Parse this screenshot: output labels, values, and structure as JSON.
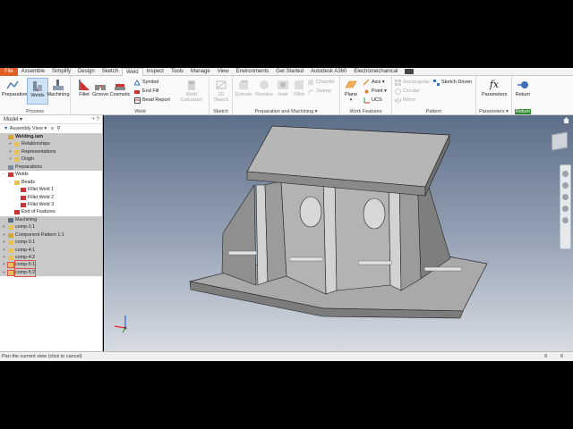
{
  "tabs": [
    {
      "label": "File"
    },
    {
      "label": "Assemble"
    },
    {
      "label": "Simplify"
    },
    {
      "label": "Design"
    },
    {
      "label": "Sketch"
    },
    {
      "label": "Weld"
    },
    {
      "label": "Inspect"
    },
    {
      "label": "Tools"
    },
    {
      "label": "Manage"
    },
    {
      "label": "View"
    },
    {
      "label": "Environments"
    },
    {
      "label": "Get Started"
    },
    {
      "label": "Autodesk A360"
    },
    {
      "label": "Electromechanical"
    }
  ],
  "ribbon": {
    "process": {
      "label": "Process",
      "preparation": "Preparation",
      "welds": "Welds",
      "machining": "Machining"
    },
    "weld": {
      "label": "Weld",
      "fillet": "Fillet",
      "groove": "Groove",
      "cosmetic": "Cosmetic",
      "symbol": "Symbol",
      "end_fill": "End Fill",
      "bead_report": "Bead Report",
      "weld_calculator": "Weld Calculator"
    },
    "sketch": {
      "label": "Sketch",
      "sketch_2d": "2D Sketch"
    },
    "prep_machining": {
      "label": "Preparation and Machining",
      "extrude": "Extrude",
      "revolve": "Revolve",
      "hole": "Hole",
      "fillet": "Fillet",
      "chamfer": "Chamfer",
      "sweep": "Sweep"
    },
    "work_features": {
      "label": "Work Features",
      "plane": "Plane",
      "axis": "Axis",
      "point": "Point",
      "ucs": "UCS"
    },
    "pattern": {
      "label": "Pattern",
      "rectangular": "Rectangular",
      "circular": "Circular",
      "mirror": "Mirror",
      "sketch_driven": "Sketch Driven"
    },
    "parameters": {
      "label": "Parameters",
      "button": "Parameters"
    },
    "return": {
      "label": "Return",
      "button": "Return"
    }
  },
  "browser": {
    "title": "Model",
    "view_mode": "Assembly View",
    "tree": [
      {
        "label": "Welding.iam",
        "indent": 0,
        "expander": "",
        "icon": "assembly-icon",
        "grey": true,
        "bold": true
      },
      {
        "label": "Relationships",
        "indent": 1,
        "expander": "+",
        "icon": "folder-icon",
        "grey": true
      },
      {
        "label": "Representations",
        "indent": 1,
        "expander": "+",
        "icon": "folder-icon",
        "grey": true
      },
      {
        "label": "Origin",
        "indent": 1,
        "expander": "+",
        "icon": "folder-icon",
        "grey": true
      },
      {
        "label": "Preparations",
        "indent": 0,
        "expander": "",
        "icon": "preparation-icon",
        "grey": true
      },
      {
        "label": "Welds",
        "indent": 0,
        "expander": "-",
        "icon": "weld-icon",
        "grey": false
      },
      {
        "label": "Beads",
        "indent": 1,
        "expander": "-",
        "icon": "folder-icon",
        "grey": false
      },
      {
        "label": "Fillet Weld 1",
        "indent": 2,
        "expander": "",
        "icon": "fillet-weld-icon",
        "grey": false
      },
      {
        "label": "Fillet Weld 2",
        "indent": 2,
        "expander": "",
        "icon": "fillet-weld-icon",
        "grey": false
      },
      {
        "label": "Fillet Weld 3",
        "indent": 2,
        "expander": "",
        "icon": "fillet-weld-icon",
        "grey": false
      },
      {
        "label": "End of Features",
        "indent": 1,
        "expander": "",
        "icon": "end-of-features-icon",
        "grey": false
      },
      {
        "label": "Machining",
        "indent": 0,
        "expander": "",
        "icon": "machining-icon",
        "grey": true
      },
      {
        "label": "comp-1:1",
        "indent": 0,
        "expander": "+",
        "icon": "part-icon",
        "grey": true
      },
      {
        "label": "Component Pattern 1:1",
        "indent": 0,
        "expander": "+",
        "icon": "pattern-icon",
        "grey": true
      },
      {
        "label": "comp-3:1",
        "indent": 0,
        "expander": "+",
        "icon": "part-icon",
        "grey": true
      },
      {
        "label": "comp-4:1",
        "indent": 0,
        "expander": "+",
        "icon": "part-icon",
        "grey": true
      },
      {
        "label": "comp-4:2",
        "indent": 0,
        "expander": "+",
        "icon": "part-icon",
        "grey": true
      },
      {
        "label": "comp-5:1",
        "indent": 0,
        "expander": "+",
        "icon": "part-icon",
        "grey": true,
        "highlight": true
      },
      {
        "label": "comp-5:2",
        "indent": 0,
        "expander": "+",
        "icon": "part-icon",
        "grey": true,
        "highlight": true
      }
    ]
  },
  "status": {
    "message": "Pan the current view (click to cancel)",
    "num1": "9",
    "num2": "6"
  },
  "colors": {
    "file_tab": "#e15e24",
    "selected_button": "#cfe3f7",
    "return_label_bg": "#2e8b2e",
    "folder": "#e8c15a",
    "part_outline_highlight": "#d9534f"
  }
}
